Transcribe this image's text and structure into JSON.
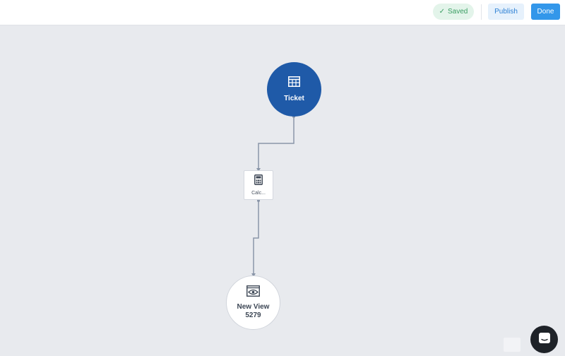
{
  "header": {
    "saved_label": "Saved",
    "publish_label": "Publish",
    "done_label": "Done"
  },
  "flow": {
    "nodes": [
      {
        "id": "ticket",
        "label": "Ticket",
        "icon": "table-icon",
        "color": "#1f5aa8"
      },
      {
        "id": "calc",
        "label": "Calc...",
        "icon": "calculator-icon"
      },
      {
        "id": "view",
        "label_line1": "New View",
        "label_line2": "5279",
        "icon": "eye-icon"
      }
    ]
  },
  "colors": {
    "accent": "#3397ea",
    "saved_text": "#3a9e63",
    "edge": "#8a96a8"
  }
}
